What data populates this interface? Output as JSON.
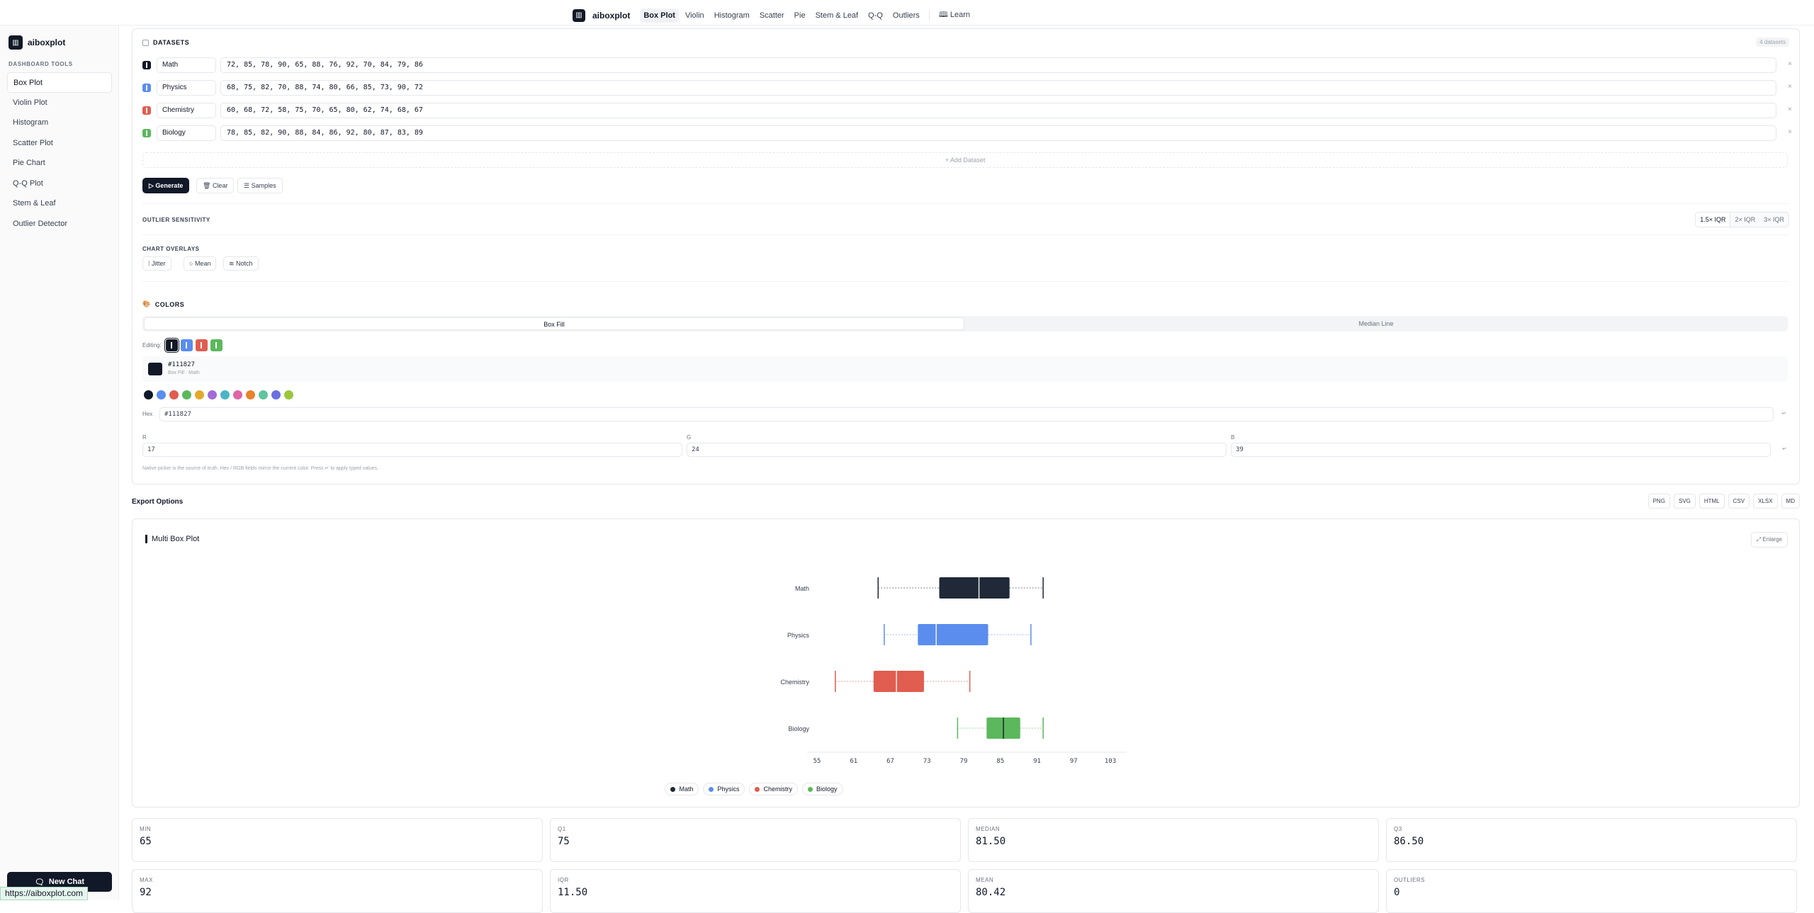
{
  "topnav": {
    "brand": "aiboxplot",
    "tabs": [
      "Box Plot",
      "Violin",
      "Histogram",
      "Scatter",
      "Pie",
      "Stem & Leaf",
      "Q-Q",
      "Outliers"
    ],
    "learn": "Learn"
  },
  "sidebar": {
    "brand": "aiboxplot",
    "section": "DASHBOARD TOOLS",
    "items": [
      "Box Plot",
      "Violin Plot",
      "Histogram",
      "Scatter Plot",
      "Pie Chart",
      "Q-Q Plot",
      "Stem & Leaf",
      "Outlier Detector"
    ],
    "new_chat": "New Chat"
  },
  "url_status": "https://aiboxplot.com",
  "datasets": {
    "title": "DATASETS",
    "count": "4 datasets",
    "rows": [
      {
        "name": "Math",
        "values": "72, 85, 78, 90, 65, 88, 76, 92, 70, 84, 79, 86",
        "color": "#111827"
      },
      {
        "name": "Physics",
        "values": "68, 75, 82, 70, 88, 74, 80, 66, 85, 73, 90, 72",
        "color": "#5b8def"
      },
      {
        "name": "Chemistry",
        "values": "60, 68, 72, 58, 75, 70, 65, 80, 62, 74, 68, 67",
        "color": "#e05d4f"
      },
      {
        "name": "Biology",
        "values": "78, 85, 82, 90, 88, 84, 86, 92, 80, 87, 83, 89",
        "color": "#5cb85c"
      }
    ],
    "add": "+ Add Dataset",
    "generate": "Generate",
    "clear": "Clear",
    "samples": "Samples"
  },
  "outlier": {
    "label": "OUTLIER SENSITIVITY",
    "options": [
      "1.5× IQR",
      "2× IQR",
      "3× IQR"
    ],
    "selected": "1.5× IQR"
  },
  "overlays": {
    "label": "CHART OVERLAYS",
    "options": [
      "Jitter",
      "Mean",
      "Notch"
    ]
  },
  "colors": {
    "title": "COLORS",
    "tabs": [
      "Box Fill",
      "Median Line"
    ],
    "editing_label": "Editing:",
    "current_hex": "#111827",
    "current_sub": "Box Fill · Math",
    "palette": [
      "#111827",
      "#5b8def",
      "#e05d4f",
      "#5cb85c",
      "#e3a92c",
      "#a26bd6",
      "#4bb5c8",
      "#e064a8",
      "#e8832c",
      "#5fc4a0",
      "#6b6fe0",
      "#9ac73b"
    ],
    "hex_label": "Hex",
    "hex_value": "#111827",
    "r_label": "R",
    "g_label": "G",
    "b_label": "B",
    "r": "17",
    "g": "24",
    "b": "39",
    "hint": "Native picker is the source of truth. Hex / RGB fields mirror the current color. Press ↵ to apply typed values."
  },
  "export": {
    "title": "Export Options",
    "buttons": [
      "PNG",
      "SVG",
      "HTML",
      "CSV",
      "XLSX",
      "MD"
    ]
  },
  "chart_panel": {
    "title": "Multi Box Plot",
    "enlarge": "Enlarge"
  },
  "chart_data": {
    "type": "box",
    "orientation": "horizontal",
    "title": "Multi Box Plot",
    "xlim": [
      55,
      103
    ],
    "ticks": [
      "55",
      "61",
      "67",
      "73",
      "79",
      "85",
      "91",
      "97",
      "103"
    ],
    "series": [
      {
        "name": "Math",
        "color": "#1f2937",
        "min": 65,
        "q1": 75,
        "median": 81.5,
        "q3": 86.5,
        "max": 92
      },
      {
        "name": "Physics",
        "color": "#5b8def",
        "min": 66,
        "q1": 71.5,
        "median": 74.5,
        "q3": 83,
        "max": 90
      },
      {
        "name": "Chemistry",
        "color": "#e05d4f",
        "min": 58,
        "q1": 64.25,
        "median": 68,
        "q3": 72.5,
        "max": 80
      },
      {
        "name": "Biology",
        "color": "#5cb85c",
        "min": 78,
        "q1": 82.75,
        "median": 85.5,
        "q3": 88.25,
        "max": 92
      }
    ],
    "legend": [
      "Math",
      "Physics",
      "Chemistry",
      "Biology"
    ]
  },
  "stats": [
    {
      "label": "MIN",
      "value": "65"
    },
    {
      "label": "Q1",
      "value": "75"
    },
    {
      "label": "MEDIAN",
      "value": "81.50"
    },
    {
      "label": "Q3",
      "value": "86.50"
    },
    {
      "label": "MAX",
      "value": "92"
    },
    {
      "label": "IQR",
      "value": "11.50"
    },
    {
      "label": "MEAN",
      "value": "80.42"
    },
    {
      "label": "OUTLIERS",
      "value": "0"
    }
  ]
}
